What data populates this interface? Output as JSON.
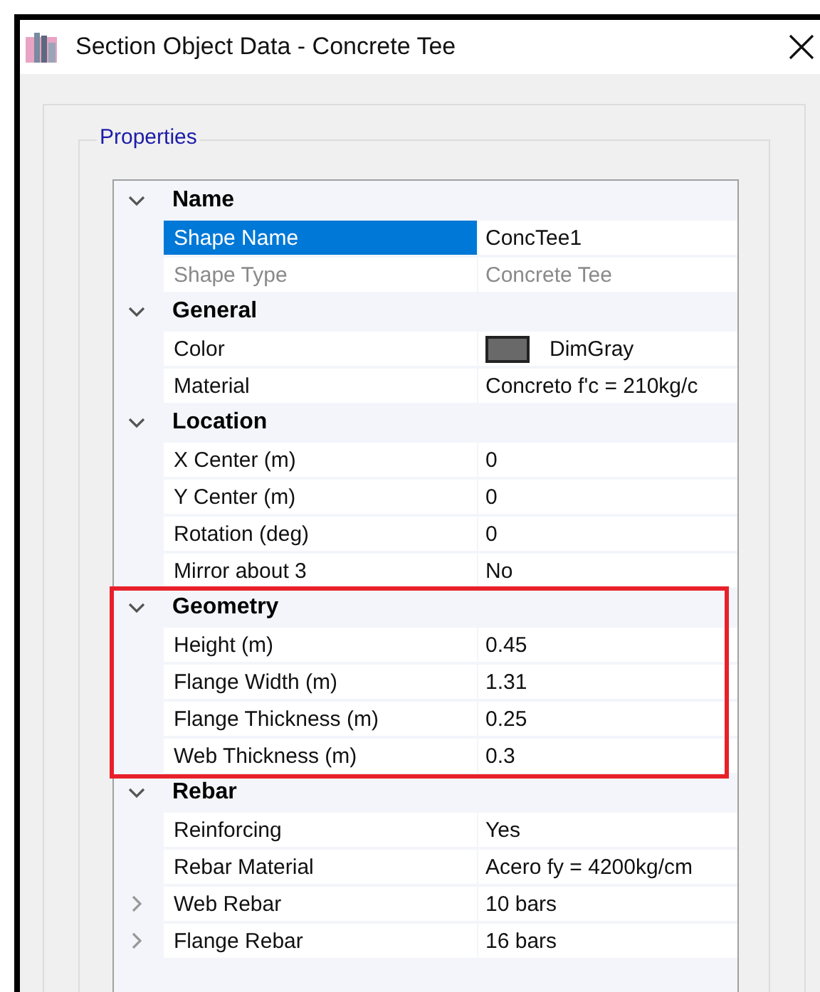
{
  "window": {
    "title": "Section Object Data - Concrete Tee"
  },
  "properties": {
    "legend": "Properties",
    "categories": [
      {
        "label": "Name",
        "expanded": true,
        "highlighted": false,
        "rows": [
          {
            "kind": "property",
            "label": "Shape Name",
            "value": "ConcTee1",
            "selected": true,
            "disabled": false
          },
          {
            "kind": "property",
            "label": "Shape Type",
            "value": "Concrete Tee",
            "selected": false,
            "disabled": true
          }
        ]
      },
      {
        "label": "General",
        "expanded": true,
        "highlighted": false,
        "rows": [
          {
            "kind": "color",
            "label": "Color",
            "value": "DimGray",
            "color": "#696969",
            "selected": false,
            "disabled": false
          },
          {
            "kind": "property",
            "label": "Material",
            "value": "Concreto f'c = 210kg/c",
            "selected": false,
            "disabled": false
          }
        ]
      },
      {
        "label": "Location",
        "expanded": true,
        "highlighted": false,
        "rows": [
          {
            "kind": "property",
            "label": "X Center (m)",
            "value": "0",
            "selected": false,
            "disabled": false
          },
          {
            "kind": "property",
            "label": "Y Center (m)",
            "value": "0",
            "selected": false,
            "disabled": false
          },
          {
            "kind": "property",
            "label": "Rotation (deg)",
            "value": "0",
            "selected": false,
            "disabled": false
          },
          {
            "kind": "property",
            "label": "Mirror about 3",
            "value": "No",
            "selected": false,
            "disabled": false
          }
        ]
      },
      {
        "label": "Geometry",
        "expanded": true,
        "highlighted": true,
        "rows": [
          {
            "kind": "property",
            "label": "Height (m)",
            "value": "0.45",
            "selected": false,
            "disabled": false
          },
          {
            "kind": "property",
            "label": "Flange Width (m)",
            "value": "1.31",
            "selected": false,
            "disabled": false
          },
          {
            "kind": "property",
            "label": "Flange Thickness (m)",
            "value": "0.25",
            "selected": false,
            "disabled": false
          },
          {
            "kind": "property",
            "label": "Web Thickness (m)",
            "value": "0.3",
            "selected": false,
            "disabled": false
          }
        ]
      },
      {
        "label": "Rebar",
        "expanded": true,
        "highlighted": false,
        "rows": [
          {
            "kind": "property",
            "label": "Reinforcing",
            "value": "Yes",
            "selected": false,
            "disabled": false
          },
          {
            "kind": "property",
            "label": "Rebar Material",
            "value": "Acero fy = 4200kg/cm",
            "selected": false,
            "disabled": false
          },
          {
            "kind": "group",
            "label": "Web Rebar",
            "value": "10 bars",
            "expanded": false,
            "selected": false,
            "disabled": false
          },
          {
            "kind": "group",
            "label": "Flange Rebar",
            "value": "16 bars",
            "expanded": false,
            "selected": false,
            "disabled": false
          }
        ]
      }
    ]
  }
}
